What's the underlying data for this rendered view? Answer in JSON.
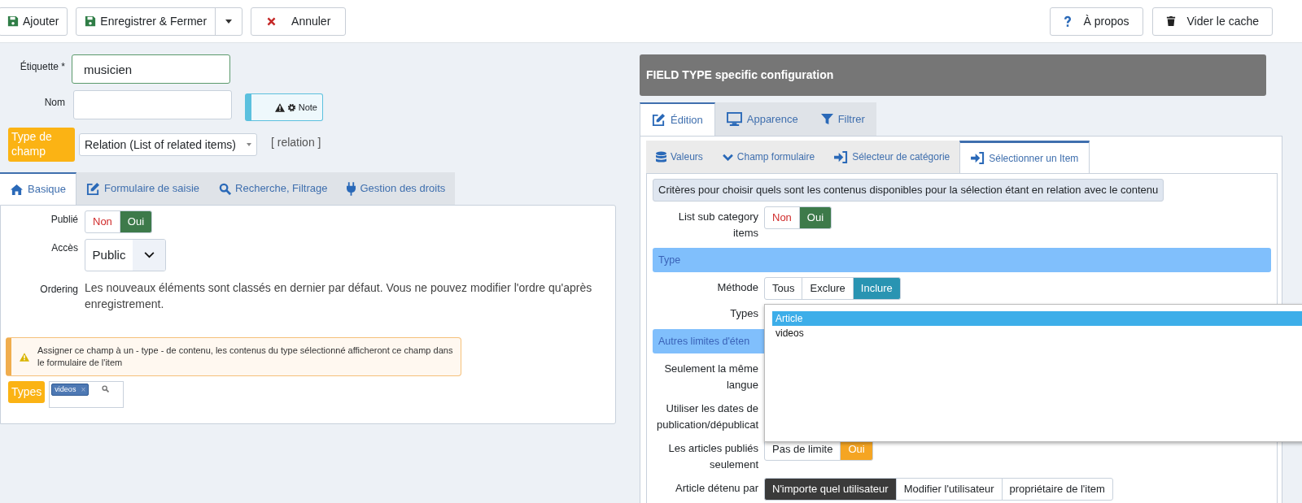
{
  "toolbar": {
    "left": [
      {
        "label": "Ajouter"
      },
      {
        "label": "Enregistrer & Fermer",
        "has_menu": true
      },
      {
        "label": "Annuler"
      }
    ],
    "right": [
      {
        "label": "À propos"
      },
      {
        "label": "Vider le cache"
      }
    ]
  },
  "left": {
    "label_field": {
      "label": "Étiquette *",
      "value": "musicien"
    },
    "name_field": {
      "label": "Nom"
    },
    "note": {
      "label": "Note"
    },
    "field_type": {
      "label": "Type de champ",
      "value": "Relation (List of related items)",
      "code": "[ relation ]"
    },
    "tabs": [
      {
        "label": "Basique",
        "selected": true
      },
      {
        "label": "Formulaire de saisie",
        "selected": false
      },
      {
        "label": "Recherche, Filtrage",
        "selected": false
      },
      {
        "label": "Gestion des droits",
        "selected": false
      }
    ],
    "published": {
      "label": "Publié",
      "options": [
        {
          "label": "Non",
          "selected": false,
          "kind": "no"
        },
        {
          "label": "Oui",
          "selected": true,
          "kind": "yes"
        }
      ]
    },
    "access": {
      "label": "Accès",
      "value": "Public"
    },
    "ordering": {
      "label": "Ordering",
      "text": "Les nouveaux éléments sont classés en dernier par défaut. Vous ne pouvez modifier l'ordre qu'après enregistrement."
    },
    "alert": "Assigner ce champ à un - type - de contenu, les contenus du type sélectionné afficheront ce champ dans le formulaire de l'item",
    "types": {
      "label": "Types",
      "tags": [
        "videos"
      ],
      "remove": "×"
    }
  },
  "right": {
    "title": "FIELD TYPE specific configuration",
    "tabs": [
      {
        "label": "Édition",
        "selected": true
      },
      {
        "label": "Apparence",
        "selected": false
      },
      {
        "label": "Filtrer",
        "selected": false
      }
    ],
    "subtabs": [
      {
        "label": "Valeurs",
        "selected": false
      },
      {
        "label": "Champ formulaire",
        "selected": false
      },
      {
        "label": "Sélecteur de catégorie",
        "selected": false
      },
      {
        "label": "Sélectionner un Item",
        "selected": true
      }
    ],
    "criteria": "Critères pour choisir quels sont les contenus disponibles pour la sélection étant en relation avec le contenu",
    "rows": [
      {
        "kind": "toggle",
        "label": "List sub category items",
        "options": [
          {
            "label": "Non",
            "selected": false,
            "kind": "no"
          },
          {
            "label": "Oui",
            "selected": true,
            "kind": "yes"
          }
        ]
      },
      {
        "kind": "section",
        "label": "Type"
      },
      {
        "kind": "toggle",
        "label": "Méthode",
        "options": [
          {
            "label": "Tous",
            "selected": false,
            "kind": "any"
          },
          {
            "label": "Exclure",
            "selected": false,
            "kind": "any"
          },
          {
            "label": "Inclure",
            "selected": true,
            "kind": "info"
          }
        ]
      },
      {
        "kind": "list",
        "label": "Types",
        "options": [
          {
            "label": "Article",
            "selected": true
          },
          {
            "label": "videos",
            "selected": false
          }
        ]
      },
      {
        "kind": "section",
        "label": "Autres limites d'éten"
      },
      {
        "kind": "hidden",
        "label": "Seulement la même langue"
      },
      {
        "kind": "hidden",
        "label": "Utiliser les dates de publication/dépublicat"
      },
      {
        "kind": "toggle",
        "label": "Les articles publiés seulement",
        "options": [
          {
            "label": "Pas de limite",
            "selected": false,
            "kind": "any"
          },
          {
            "label": "Oui",
            "selected": true,
            "kind": "warn"
          }
        ]
      },
      {
        "kind": "toggle",
        "label": "Article détenu par",
        "options": [
          {
            "label": "N'importe quel utilisateur",
            "selected": true,
            "kind": "dark"
          },
          {
            "label": "Modifier l'utilisateur",
            "selected": false,
            "kind": "any"
          },
          {
            "label": "propriétaire de l'item",
            "selected": false,
            "kind": "any"
          }
        ]
      }
    ]
  }
}
